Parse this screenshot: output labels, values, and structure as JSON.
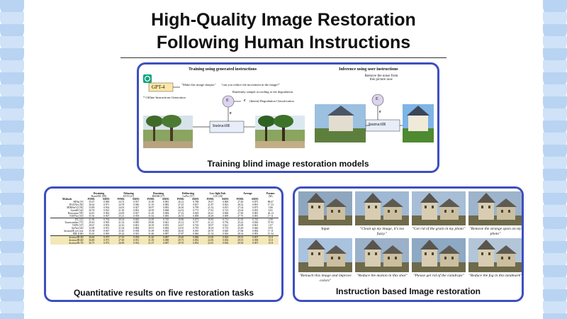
{
  "title": {
    "line1": "High-Quality Image Restoration",
    "line2": "Following Human Instructions"
  },
  "top_panel": {
    "caption": "Training blind image restoration models",
    "left_heading": "Training using generated instructions",
    "right_heading": "Inference using user instructions",
    "gpt_label": "GPT-4",
    "offline_note": "* Offline Instructions Generation",
    "prompt_a": "\"Make this image sharper.\"",
    "prompt_b": "\"can you reduce the movement in the image?\"",
    "sample_note": "Randomly sample according to the degradation",
    "encoder_label": "E",
    "c_note": "(Intent) Degradation Classification",
    "c_symbol": "c",
    "e_symbol": "e",
    "model_label": "InstructIR",
    "user_instruction": "Remove the noise from this picture now",
    "model_label_right": "InstructIR",
    "e_symbol_right": "e",
    "encoder_label_right": "E"
  },
  "table_panel": {
    "caption": "Quantitative results on five restoration tasks",
    "group_headers": [
      "Deraining",
      "Dehazing",
      "Denoising",
      "Deblurring",
      "Low-light Enh.",
      "Average",
      "Params"
    ],
    "datasets": [
      "Rain100L [88]",
      "SOTS [41]",
      "BSD68 [57]",
      "GoPro [57]",
      "LOL [83]",
      "",
      "(M)"
    ],
    "metric_header": [
      "Methods",
      "PSNR↑",
      "SSIM↑",
      "PSNR↑",
      "SSIM↑",
      "PSNR↑",
      "SSIM↑",
      "PSNR↑",
      "SSIM↑",
      "PSNR↑",
      "SSIM↑",
      "PSNR↑",
      "SSIM↑",
      ""
    ],
    "rows": [
      [
        "HINet [9]",
        "35.67",
        "0.969",
        "24.74",
        "0.937",
        "31.00",
        "0.881",
        "26.12",
        "0.788",
        "19.47",
        "0.800",
        "27.40",
        "0.875",
        "88.67"
      ],
      [
        "DGUNet [56]",
        "36.62",
        "0.971",
        "24.78",
        "0.940",
        "31.10",
        "0.883",
        "27.25",
        "0.837",
        "21.87",
        "0.823",
        "28.32",
        "0.891",
        "17.33"
      ],
      [
        "MIRNetV2 [93]",
        "33.89",
        "0.954",
        "24.03",
        "0.927",
        "30.97",
        "0.881",
        "26.30",
        "0.799",
        "21.52",
        "0.815",
        "27.34",
        "0.875",
        "5.86"
      ],
      [
        "SwinIR [44]",
        "30.78",
        "0.923",
        "21.50",
        "0.891",
        "30.59",
        "0.868",
        "24.52",
        "0.773",
        "17.81",
        "0.723",
        "25.04",
        "0.835",
        "0.91"
      ],
      [
        "Restormer [95]",
        "34.81",
        "0.962",
        "24.09",
        "0.927",
        "31.49",
        "0.884",
        "27.22",
        "0.829",
        "20.41",
        "0.806",
        "27.60",
        "0.881",
        "26.13"
      ],
      [
        "NAFNet [10]",
        "35.56",
        "0.967",
        "25.23",
        "0.939",
        "31.02",
        "0.883",
        "26.53",
        "0.808",
        "20.49",
        "0.809",
        "27.76",
        "0.881",
        "17.11"
      ],
      [
        "DL [21]",
        "21.96",
        "0.762",
        "20.54",
        "0.826",
        "23.09",
        "0.745",
        "19.86",
        "0.672",
        "19.83",
        "0.712",
        "21.05",
        "0.743",
        "2.09"
      ],
      [
        "Transweather [75]",
        "29.43",
        "0.905",
        "21.32",
        "0.885",
        "29.00",
        "0.841",
        "25.12",
        "0.757",
        "21.21",
        "0.792",
        "25.22",
        "0.836",
        "37.93"
      ],
      [
        "TAPE [47]",
        "29.67",
        "0.904",
        "22.16",
        "0.861",
        "30.18",
        "0.855",
        "24.47",
        "0.763",
        "18.97",
        "0.621",
        "25.09",
        "0.801",
        "1.07"
      ],
      [
        "AirNet [42]",
        "32.98",
        "0.951",
        "21.04",
        "0.884",
        "30.91",
        "0.882",
        "24.35",
        "0.781",
        "18.18",
        "0.735",
        "25.49",
        "0.846",
        "8.93"
      ],
      [
        "InstructIR w/o text",
        "35.58",
        "0.967",
        "25.20",
        "0.938",
        "31.09",
        "0.883",
        "26.65",
        "0.810",
        "20.70",
        "0.820",
        "27.84",
        "0.884",
        "17.11"
      ],
      [
        "IDR [100]",
        "35.63",
        "0.965",
        "25.24",
        "0.943",
        "31.60",
        "0.887",
        "27.87",
        "0.846",
        "21.34",
        "0.826",
        "28.34",
        "0.893",
        "15.34"
      ],
      [
        "InstructIR-5D",
        "36.84",
        "0.973",
        "27.10",
        "0.956",
        "31.40",
        "0.887",
        "29.40",
        "0.886",
        "23.00",
        "0.836",
        "29.55",
        "0.907",
        "15.8"
      ],
      [
        "InstructIR-6D",
        "36.80",
        "0.973",
        "27.00",
        "0.951",
        "31.39",
        "0.888",
        "29.73",
        "0.892",
        "22.83",
        "0.836",
        "29.55",
        "0.908",
        "15.8"
      ],
      [
        "InstructIR-7D",
        "36.75",
        "0.972",
        "26.90",
        "0.952",
        "31.37",
        "0.887",
        "29.70",
        "0.892",
        "22.81",
        "0.836",
        "29.50",
        "0.907",
        "15.8"
      ]
    ]
  },
  "grid_panel": {
    "caption": "Instruction based Image restoration",
    "captions_row1": [
      "Input",
      "\"Clean up my image, it's too fuzzy.\"",
      "\"Get rid of the grain in my photo\"",
      "\"Remove the strange spots on my photo\""
    ],
    "captions_row2": [
      "\"Retouch this image and improve colors\"",
      "\"Reduce the motion in this shot\"",
      "\"Please get rid of the raindrops\"",
      "\"Reduce the fog in this landmark\""
    ]
  },
  "colors": {
    "accent": "#3d4fbf",
    "scallop": "#b9d4f2",
    "highlight": "#f3e8b8"
  }
}
